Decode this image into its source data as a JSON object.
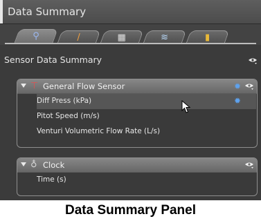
{
  "window": {
    "title": "Data Summary"
  },
  "tabs": [
    {
      "name": "probe-tab",
      "glyph": "⚲",
      "color": "#9bb8f2",
      "active": true
    },
    {
      "name": "pencil-tab",
      "glyph": "/",
      "color": "#f0a040",
      "active": false
    },
    {
      "name": "calculator-tab",
      "glyph": "▦",
      "color": "#e0e0e0",
      "active": false
    },
    {
      "name": "beaker-tab",
      "glyph": "≋",
      "color": "#b8d8f8",
      "active": false
    },
    {
      "name": "bar-graph-tab",
      "glyph": "▮",
      "color": "#e8b838",
      "active": false
    }
  ],
  "section": {
    "label": "Sensor Data Summary"
  },
  "groups": [
    {
      "name": "General Flow Sensor",
      "icon": "flow-sensor-icon",
      "glyph": "⊤",
      "glyph_color": "#e05050",
      "items": [
        {
          "label": "Diff Press (kPa)",
          "selected": true
        },
        {
          "label": "Pitot Speed (m/s)",
          "selected": false
        },
        {
          "label": "Venturi Volumetric Flow Rate (L/s)",
          "selected": false
        }
      ]
    },
    {
      "name": "Clock",
      "icon": "stopwatch-icon",
      "glyph": "♁",
      "glyph_color": "#d8d8d8",
      "items": [
        {
          "label": "Time (s)",
          "selected": false
        }
      ]
    }
  ],
  "caption": "Data Summary Panel",
  "colors": {
    "gear": "#5ea2ee",
    "panel_bg": "#3b3b3b"
  }
}
